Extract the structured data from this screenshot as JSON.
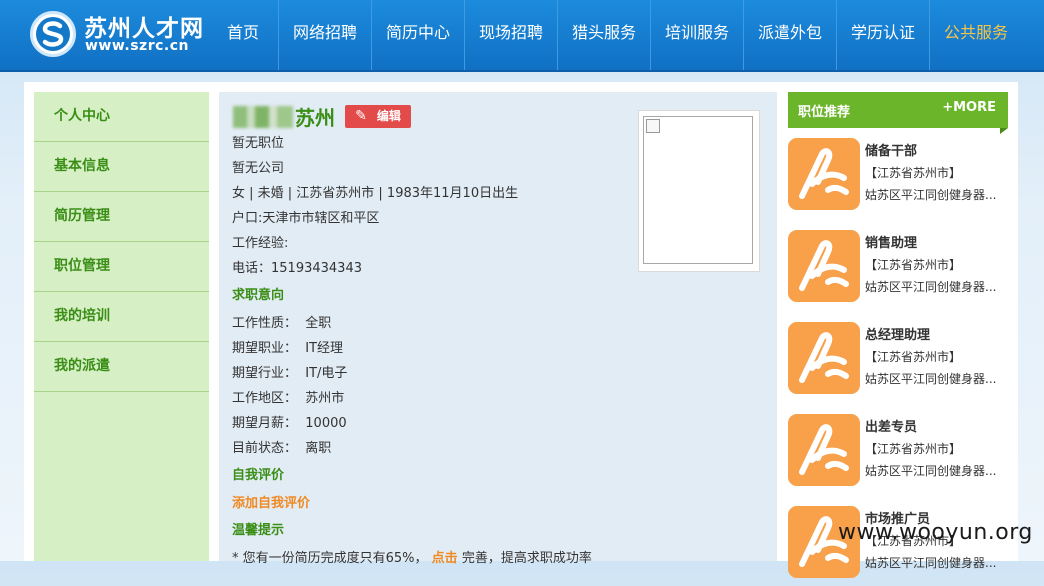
{
  "header": {
    "logo_cn": "苏州人才网",
    "logo_en": "www.szrc.cn",
    "nav": [
      {
        "label": "首页"
      },
      {
        "label": "网络招聘"
      },
      {
        "label": "简历中心"
      },
      {
        "label": "现场招聘"
      },
      {
        "label": "猎头服务"
      },
      {
        "label": "培训服务"
      },
      {
        "label": "派遣外包"
      },
      {
        "label": "学历认证"
      },
      {
        "label": "公共服务"
      }
    ],
    "active_color": "#f7c44a"
  },
  "sidebar": {
    "items": [
      {
        "label": "个人中心"
      },
      {
        "label": "基本信息"
      },
      {
        "label": "简历管理"
      },
      {
        "label": "职位管理"
      },
      {
        "label": "我的培训"
      },
      {
        "label": "我的派遣"
      }
    ]
  },
  "profile": {
    "name_suffix": "苏州",
    "edit_label": "编辑",
    "position": "暂无职位",
    "company": "暂无公司",
    "basic": "女 | 未婚 | 江苏省苏州市 | 1983年11月10日出生",
    "hukou": "户口:天津市市辖区和平区",
    "experience": "工作经验:",
    "phone": "电话：15193434343",
    "intent_title": "求职意向",
    "intent": [
      {
        "label": "工作性质：",
        "value": "全职"
      },
      {
        "label": "期望职业：",
        "value": "IT经理"
      },
      {
        "label": "期望行业：",
        "value": "IT/电子"
      },
      {
        "label": "工作地区：",
        "value": "苏州市"
      },
      {
        "label": "期望月薪：",
        "value": "10000"
      },
      {
        "label": "目前状态：",
        "value": "离职"
      }
    ],
    "self_eval_title": "自我评价",
    "add_self_eval": "添加自我评价",
    "tips_title": "温馨提示",
    "tip_prefix": "* 您有一份简历完成度只有65%，",
    "tip_link": "点击",
    "tip_suffix": " 完善，提高求职成功率"
  },
  "recommend": {
    "title": "职位推荐",
    "more": "+MORE",
    "jobs": [
      {
        "title": "储备干部",
        "location": "【江苏省苏州市】",
        "company": "姑苏区平江同创健身器..."
      },
      {
        "title": "销售助理",
        "location": "【江苏省苏州市】",
        "company": "姑苏区平江同创健身器..."
      },
      {
        "title": "总经理助理",
        "location": "【江苏省苏州市】",
        "company": "姑苏区平江同创健身器..."
      },
      {
        "title": "出差专员",
        "location": "【江苏省苏州市】",
        "company": "姑苏区平江同创健身器..."
      },
      {
        "title": "市场推广员",
        "location": "【江苏省苏州市】",
        "company": "姑苏区平江同创健身器..."
      }
    ]
  },
  "watermark": "www.wooyun.org"
}
